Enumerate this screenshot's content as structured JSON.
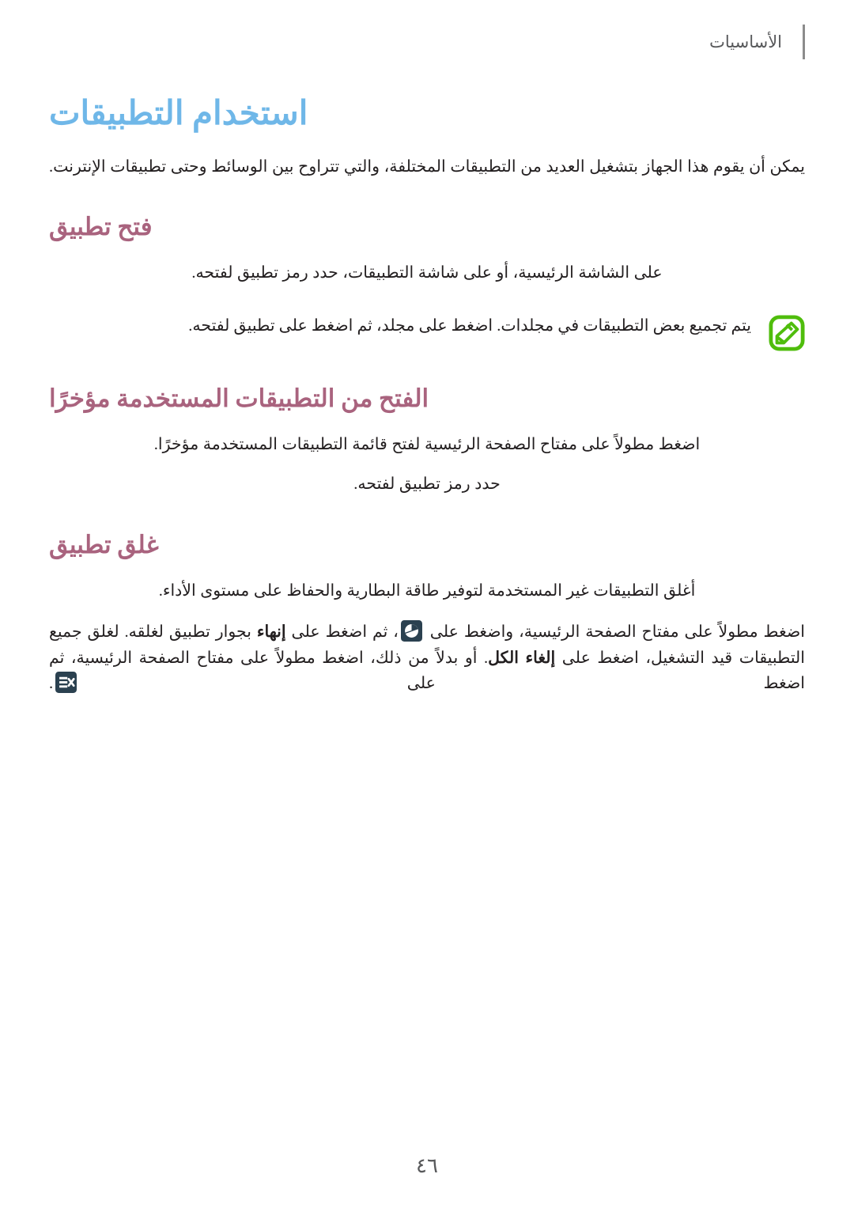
{
  "header": {
    "running_head": "الأساسيات",
    "rule_color": "#8c8c8c"
  },
  "colors": {
    "chapter_title": "#6fb7e8",
    "section_title": "#a9637e",
    "body_text": "#231f20",
    "note_icon": "#4fbd0c",
    "ui_icon_bg": "#2b4150",
    "ui_icon_fg": "#ffffff"
  },
  "chapter": {
    "title": "استخدام التطبيقات",
    "intro": "يمكن أن يقوم هذا الجهاز بتشغيل العديد من التطبيقات المختلفة، والتي تتراوح بين الوسائط وحتى تطبيقات الإنترنت."
  },
  "sections": [
    {
      "id": "open-app",
      "title": "فتح تطبيق",
      "paragraph": "على الشاشة الرئيسية، أو على شاشة التطبيقات، حدد رمز تطبيق لفتحه.",
      "note": {
        "icon": "note-pencil-icon",
        "text": "يتم تجميع بعض التطبيقات في مجلدات. اضغط على مجلد، ثم اضغط على تطبيق لفتحه."
      }
    },
    {
      "id": "open-from-recent",
      "title": "الفتح من التطبيقات المستخدمة مؤخرًا",
      "paragraph_1": "اضغط مطولاً على مفتاح الصفحة الرئيسية لفتح قائمة التطبيقات المستخدمة مؤخرًا.",
      "paragraph_2": "حدد رمز تطبيق لفتحه."
    },
    {
      "id": "close-app",
      "title": "غلق تطبيق",
      "paragraph_1": "أغلق التطبيقات غير المستخدمة لتوفير طاقة البطارية والحفاظ على مستوى الأداء.",
      "paragraph_2": {
        "part_1": "اضغط مطولاً على مفتاح الصفحة الرئيسية، واضغط على ",
        "icon_1": "task-manager-icon",
        "part_2": "، ثم اضغط على ",
        "bold_1": "إنهاء",
        "part_3": " بجوار تطبيق لغلقه. لغلق جميع التطبيقات قيد التشغيل، اضغط على ",
        "bold_2": "إلغاء الكل",
        "part_4": ". أو بدلاً من ذلك، اضغط مطولاً على مفتاح الصفحة الرئيسية، ثم اضغط على ",
        "icon_2": "close-all-icon",
        "part_5": "."
      }
    }
  ],
  "footer": {
    "page_number": "٤٦"
  }
}
